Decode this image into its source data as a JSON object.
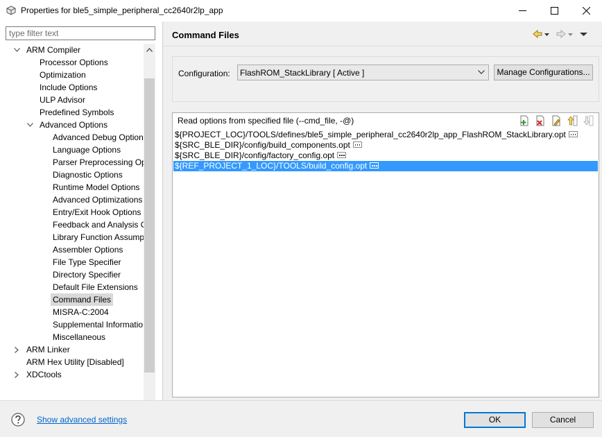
{
  "window": {
    "title": "Properties for ble5_simple_peripheral_cc2640r2lp_app",
    "minimize_icon": "minimize-icon",
    "maximize_icon": "maximize-icon",
    "close_icon": "close-icon"
  },
  "filter": {
    "placeholder": "type filter text",
    "value": ""
  },
  "tree": {
    "items": [
      {
        "label": "ARM Compiler",
        "depth": 1,
        "twisty": "expanded"
      },
      {
        "label": "Processor Options",
        "depth": 2,
        "twisty": "none"
      },
      {
        "label": "Optimization",
        "depth": 2,
        "twisty": "none"
      },
      {
        "label": "Include Options",
        "depth": 2,
        "twisty": "none"
      },
      {
        "label": "ULP Advisor",
        "depth": 2,
        "twisty": "none"
      },
      {
        "label": "Predefined Symbols",
        "depth": 2,
        "twisty": "none"
      },
      {
        "label": "Advanced Options",
        "depth": 2,
        "twisty": "expanded"
      },
      {
        "label": "Advanced Debug Options",
        "depth": 3,
        "twisty": "none"
      },
      {
        "label": "Language Options",
        "depth": 3,
        "twisty": "none"
      },
      {
        "label": "Parser Preprocessing Options",
        "depth": 3,
        "twisty": "none"
      },
      {
        "label": "Diagnostic Options",
        "depth": 3,
        "twisty": "none"
      },
      {
        "label": "Runtime Model Options",
        "depth": 3,
        "twisty": "none"
      },
      {
        "label": "Advanced Optimizations",
        "depth": 3,
        "twisty": "none"
      },
      {
        "label": "Entry/Exit Hook Options",
        "depth": 3,
        "twisty": "none"
      },
      {
        "label": "Feedback and Analysis Options",
        "depth": 3,
        "twisty": "none"
      },
      {
        "label": "Library Function Assumptions",
        "depth": 3,
        "twisty": "none"
      },
      {
        "label": "Assembler Options",
        "depth": 3,
        "twisty": "none"
      },
      {
        "label": "File Type Specifier",
        "depth": 3,
        "twisty": "none"
      },
      {
        "label": "Directory Specifier",
        "depth": 3,
        "twisty": "none"
      },
      {
        "label": "Default File Extensions",
        "depth": 3,
        "twisty": "none"
      },
      {
        "label": "Command Files",
        "depth": 3,
        "twisty": "none",
        "selected": true
      },
      {
        "label": "MISRA-C:2004",
        "depth": 3,
        "twisty": "none"
      },
      {
        "label": "Supplemental Information",
        "depth": 3,
        "twisty": "none"
      },
      {
        "label": "Miscellaneous",
        "depth": 3,
        "twisty": "none"
      },
      {
        "label": "ARM Linker",
        "depth": 1,
        "twisty": "collapsed"
      },
      {
        "label": "ARM Hex Utility  [Disabled]",
        "depth": 1,
        "twisty": "none"
      },
      {
        "label": "XDCtools",
        "depth": 1,
        "twisty": "collapsed"
      }
    ]
  },
  "page": {
    "title": "Command Files",
    "nav_icons": [
      "back-arrow-icon",
      "back-dropdown-icon",
      "forward-arrow-icon",
      "forward-dropdown-icon",
      "view-menu-icon"
    ]
  },
  "configuration": {
    "label": "Configuration:",
    "selected": "FlashROM_StackLibrary  [ Active ]",
    "manage_label": "Manage Configurations..."
  },
  "cmd_files": {
    "header": "Read options from specified file (--cmd_file, -@)",
    "toolbar": [
      "add-file-icon",
      "delete-file-icon",
      "edit-file-icon",
      "move-up-icon",
      "move-down-icon"
    ],
    "rows": [
      "${PROJECT_LOC}/TOOLS/defines/ble5_simple_peripheral_cc2640r2lp_app_FlashROM_StackLibrary.opt",
      "${SRC_BLE_DIR}/config/build_components.opt",
      "${SRC_BLE_DIR}/config/factory_config.opt",
      "${REF_PROJECT_1_LOC}/TOOLS/build_config.opt"
    ],
    "selected_index": 3
  },
  "footer": {
    "help_icon": "help-icon",
    "advanced_link": "Show advanced settings",
    "ok_label": "OK",
    "cancel_label": "Cancel"
  },
  "colors": {
    "selection": "#3399ff",
    "tree_selection": "#d9d9d9",
    "link": "#0066cc",
    "default_button_border": "#0078d7"
  }
}
